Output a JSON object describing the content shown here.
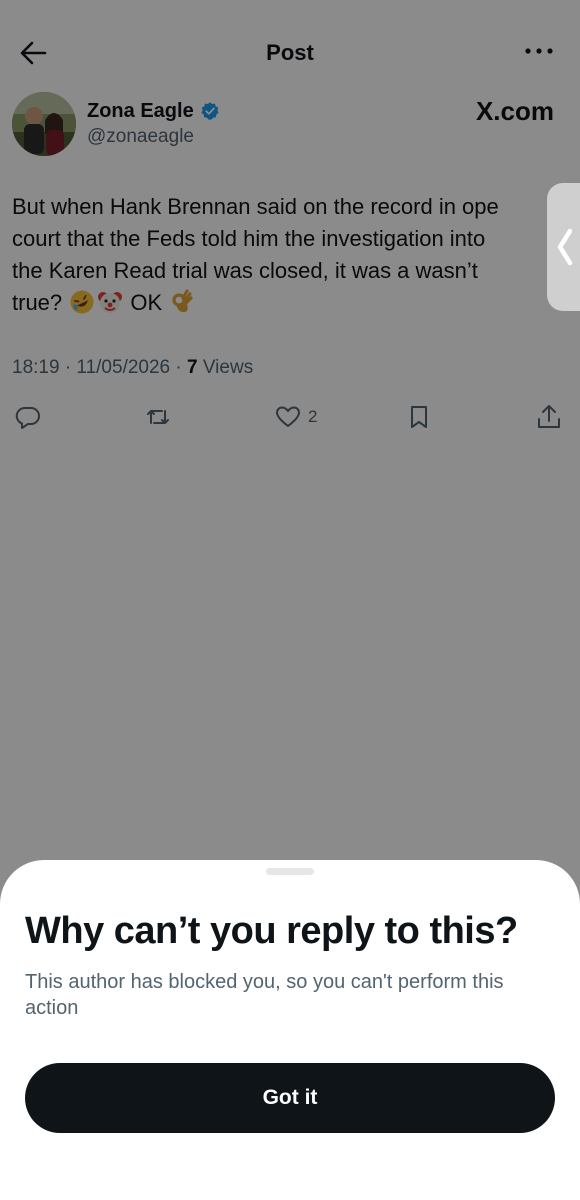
{
  "header": {
    "title": "Post",
    "back_icon": "arrow-left-icon",
    "more_icon": "more-horizontal-icon"
  },
  "author": {
    "name": "Zona Eagle",
    "handle": "@zonaeagle",
    "verified": true,
    "verified_color": "#1d9bf0",
    "avatar": "avatar-photo"
  },
  "source_label": "X.com",
  "post": {
    "lines": [
      "But when Hank Brennan said on the record in ope",
      "court that the Feds told him the investigation into",
      "the Karen Read trial was closed, it was a wasn’t",
      "true?"
    ],
    "emojis": [
      "rolling-on-floor-laughing-emoji",
      "clown-face-emoji"
    ],
    "ok_text": "OK",
    "final_emoji": "ok-hand-emoji"
  },
  "meta": {
    "time_date": "18:19 · 11/05/2026 · ",
    "views_count": "7",
    "views_label": " Views"
  },
  "actions": {
    "reply_icon": "reply-icon",
    "repost_icon": "repost-icon",
    "like_icon": "like-heart-icon",
    "like_count": "2",
    "bookmark_icon": "bookmark-icon",
    "share_icon": "share-icon"
  },
  "side_handle_icon": "chevron-left-icon",
  "sheet": {
    "title": "Why can’t you reply to this?",
    "description": "This author has blocked you, so you can't perform this action",
    "button_label": "Got it"
  },
  "colors": {
    "text_primary": "#0f1419",
    "text_secondary": "#536471",
    "button_bg": "#0f1419",
    "overlay": "rgba(0,0,0,0.455)"
  }
}
